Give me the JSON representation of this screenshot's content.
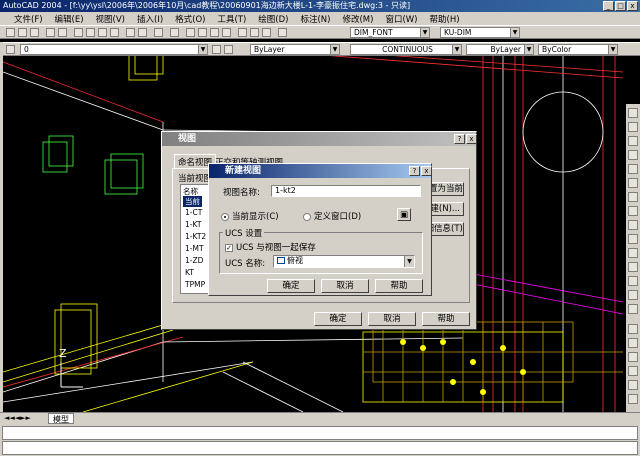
{
  "window": {
    "title": "AutoCAD 2004 - [f:\\yy\\ysl\\2006年\\2006年10月\\cad教程\\20060901海边新大楼L-1-李豪振住宅.dwg:3 - 只读]",
    "min": "_",
    "max": "□",
    "close": "x"
  },
  "menu": [
    "文件(F)",
    "编辑(E)",
    "视图(V)",
    "插入(I)",
    "格式(O)",
    "工具(T)",
    "绘图(D)",
    "标注(N)",
    "修改(M)",
    "窗口(W)",
    "帮助(H)"
  ],
  "toolbar": {
    "layer_value": "0",
    "color_value": "ByLayer",
    "linetype_value": "CONTINUOUS",
    "lineweight_value": "ByLayer",
    "plotstyle_value": "ByColor",
    "textstyle_value": "DIM_FONT",
    "dimstyle_value": "KU-DIM"
  },
  "layout_tabs": [
    "模型"
  ],
  "view_dialog": {
    "title": "视图",
    "help": "?",
    "close": "x",
    "tabs": [
      "命名视图",
      "正交和等轴测视图"
    ],
    "current_view_label": "当前视图",
    "list_header": "名称",
    "list_items": [
      "当前",
      "1-CT",
      "1-KT",
      "1-KT2",
      "1-MT",
      "1-ZD",
      "KT",
      "TPMP"
    ],
    "side_buttons": [
      "置为当前(C)",
      "新建(N)...",
      "详细信息(T)"
    ],
    "ok": "确定",
    "cancel": "取消",
    "help_btn": "帮助"
  },
  "new_view_dialog": {
    "title": "新建视图",
    "help": "?",
    "close": "x",
    "name_label": "视图名称:",
    "name_value": "1-kt2",
    "radio_current": "当前显示(C)",
    "radio_window": "定义窗口(D)",
    "ucs_group": "UCS 设置",
    "ucs_checkbox": "UCS 与视图一起保存",
    "ucs_name_label": "UCS 名称:",
    "ucs_name_value": "俯视",
    "ok": "确定",
    "cancel": "取消",
    "help_btn": "帮助"
  }
}
